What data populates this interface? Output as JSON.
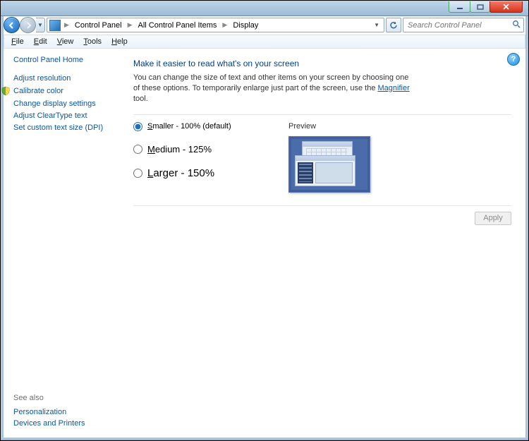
{
  "window": {
    "buttons": {
      "min": "–",
      "max": "❐",
      "close": "×"
    }
  },
  "breadcrumb": {
    "segs": [
      "Control Panel",
      "All Control Panel Items",
      "Display"
    ]
  },
  "search": {
    "placeholder": "Search Control Panel"
  },
  "menubar": [
    "File",
    "Edit",
    "View",
    "Tools",
    "Help"
  ],
  "sidebar": {
    "home": "Control Panel Home",
    "links": [
      "Adjust resolution",
      "Calibrate color",
      "Change display settings",
      "Adjust ClearType text",
      "Set custom text size (DPI)"
    ],
    "seealso_hdr": "See also",
    "seealso": [
      "Personalization",
      "Devices and Printers"
    ]
  },
  "main": {
    "title": "Make it easier to read what's on your screen",
    "desc_a": "You can change the size of text and other items on your screen by choosing one of these options. To temporarily enlarge just part of the screen, use the ",
    "desc_link": "Magnifier",
    "desc_b": " tool.",
    "options": [
      {
        "label": "Smaller - 100% (default)",
        "value": "100",
        "checked": true
      },
      {
        "label": "Medium - 125%",
        "value": "125",
        "checked": false
      },
      {
        "label": "Larger - 150%",
        "value": "150",
        "checked": false
      }
    ],
    "preview_label": "Preview",
    "apply": "Apply",
    "help": "?"
  }
}
